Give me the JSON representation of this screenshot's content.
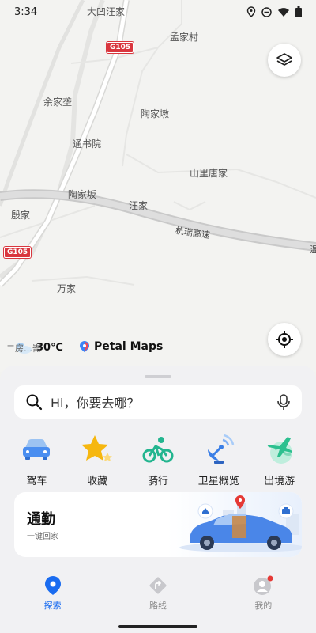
{
  "status": {
    "time": "3:34"
  },
  "map": {
    "places": [
      {
        "name": "大凹汪家",
        "id": "place-daaowangjia"
      },
      {
        "name": "孟家村",
        "id": "place-mengjiacun"
      },
      {
        "name": "余家垄",
        "id": "place-yujialong"
      },
      {
        "name": "陶家墩",
        "id": "place-taojiadun"
      },
      {
        "name": "通书院",
        "id": "place-tongshuyuan"
      },
      {
        "name": "山里唐家",
        "id": "place-shanlitangjia"
      },
      {
        "name": "陶家坂",
        "id": "place-taojiaban"
      },
      {
        "name": "汪家",
        "id": "place-wangjia"
      },
      {
        "name": "殷家",
        "id": "place-yinjia"
      },
      {
        "name": "万家",
        "id": "place-wanjia"
      }
    ],
    "road_labels": {
      "expressway": "杭瑞高速",
      "edge": "温"
    },
    "shields": {
      "top": "G105",
      "left": "G105"
    },
    "weather": {
      "place_partial": "二房…崙",
      "temp": "30℃"
    },
    "brand": "Petal Maps"
  },
  "search": {
    "placeholder": "Hi，你要去哪？"
  },
  "quick_actions": [
    {
      "label": "驾车",
      "icon": "car-icon"
    },
    {
      "label": "收藏",
      "icon": "star-icon"
    },
    {
      "label": "骑行",
      "icon": "bicycle-icon"
    },
    {
      "label": "卫星概览",
      "icon": "satellite-icon"
    },
    {
      "label": "出境游",
      "icon": "airplane-globe-icon"
    }
  ],
  "commute": {
    "title": "通勤",
    "subtitle": "一键回家"
  },
  "tabs": [
    {
      "label": "探索",
      "icon": "location-pin-icon",
      "active": true
    },
    {
      "label": "路线",
      "icon": "route-icon",
      "active": false
    },
    {
      "label": "我的",
      "icon": "avatar-icon",
      "active": false
    }
  ],
  "colors": {
    "accent": "#1a6cf0",
    "shield": "#d9363e",
    "notification_dot": "#e53935"
  }
}
